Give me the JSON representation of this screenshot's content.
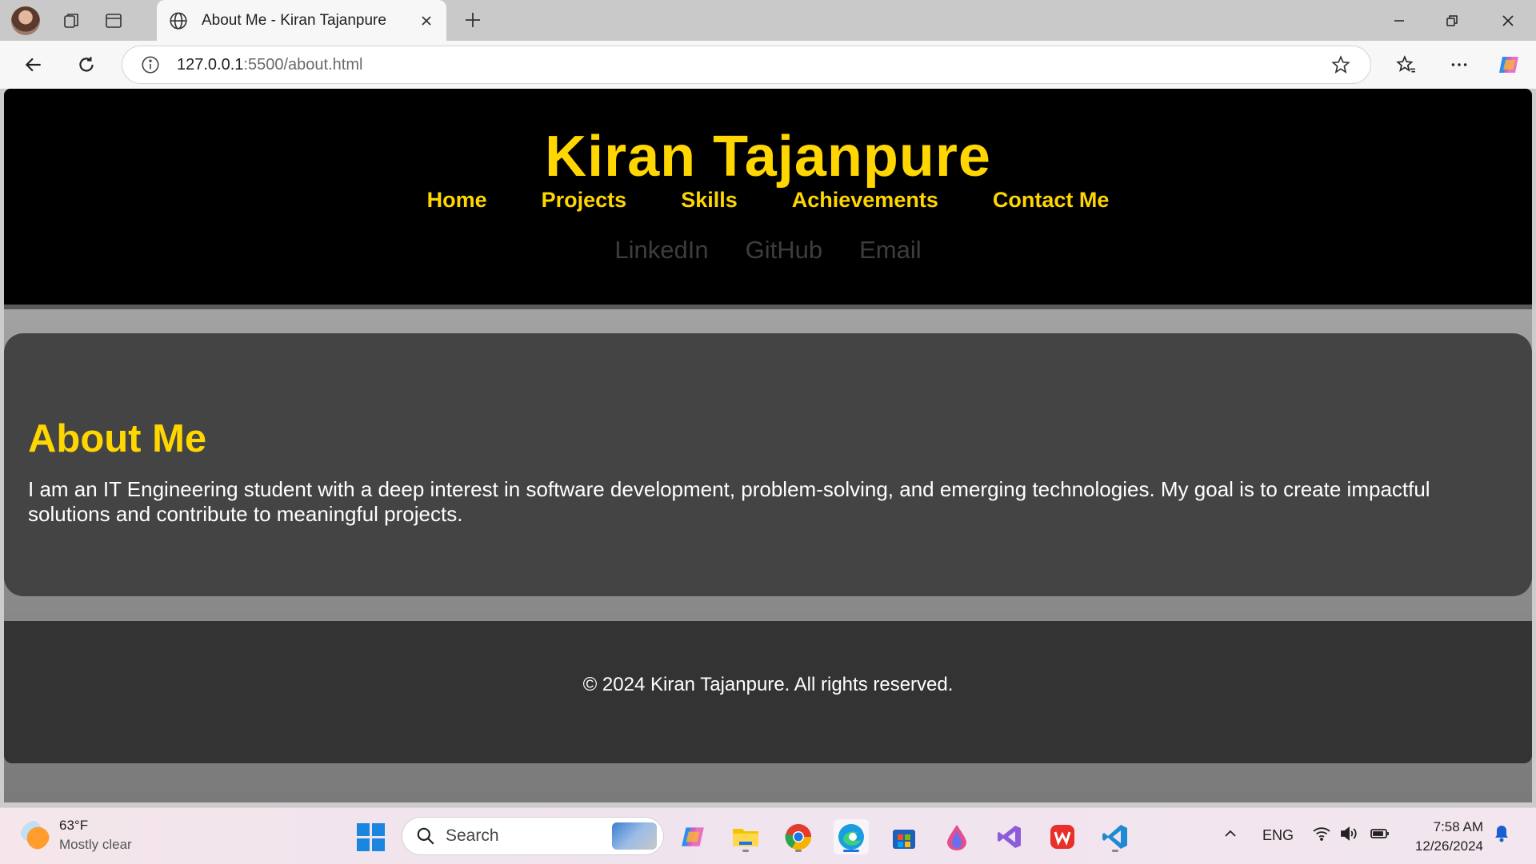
{
  "browser": {
    "tab_title": "About Me - Kiran Tajanpure",
    "url_host": "127.0.0.1",
    "url_rest": ":5500/about.html"
  },
  "site": {
    "title": "Kiran Tajanpure",
    "nav": [
      "Home",
      "Projects",
      "Skills",
      "Achievements",
      "Contact Me"
    ],
    "social": [
      "LinkedIn",
      "GitHub",
      "Email"
    ],
    "about_heading": "About Me",
    "about_text": "I am an IT Engineering student with a deep interest in software development, problem-solving, and emerging technologies. My goal is to create impactful solutions and contribute to meaningful projects.",
    "footer": "© 2024 Kiran Tajanpure. All rights reserved."
  },
  "taskbar": {
    "temperature": "63°F",
    "condition": "Mostly clear",
    "search_label": "Search",
    "language": "ENG",
    "time": "7:58 AM",
    "date": "12/26/2024"
  },
  "colors": {
    "accent_yellow": "#ffd600",
    "header_bg": "#000000",
    "card_bg": "#444444",
    "footer_bg": "#333333"
  }
}
